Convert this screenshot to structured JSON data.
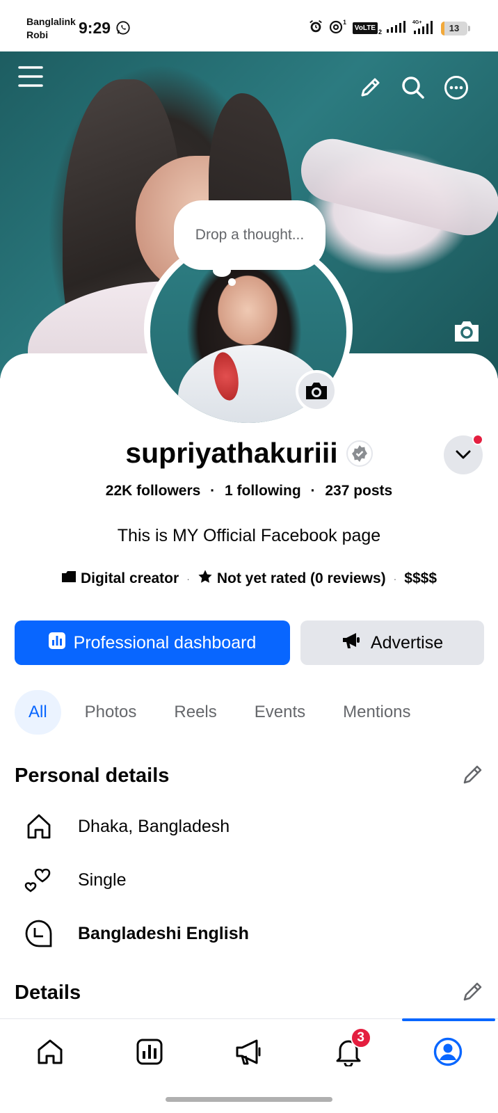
{
  "status_bar": {
    "carrier_line1": "Banglalink",
    "carrier_line2": "Robi",
    "time": "9:29",
    "volte_label": "VoLTE",
    "sim2_label": "2",
    "battery_level": "13",
    "battery_fraction": 0.13,
    "battery_color": "#f2a93b"
  },
  "cover": {
    "icons": [
      "menu-icon",
      "pencil-icon",
      "search-icon",
      "more-icon",
      "camera-icon"
    ]
  },
  "profile": {
    "thought_placeholder": "Drop a thought...",
    "name": "supriyathakuriii",
    "followers": "22K followers",
    "following": "1 following",
    "posts": "237 posts",
    "separator": "·",
    "bio": "This is MY Official Facebook page",
    "category": "Digital creator",
    "rating": "Not yet rated (0 reviews)",
    "price": "$$$$"
  },
  "actions": {
    "primary_label": "Professional dashboard",
    "secondary_label": "Advertise",
    "accent_color": "#0866ff"
  },
  "tabs": [
    {
      "label": "All",
      "active": true
    },
    {
      "label": "Photos",
      "active": false
    },
    {
      "label": "Reels",
      "active": false
    },
    {
      "label": "Events",
      "active": false
    },
    {
      "label": "Mentions",
      "active": false
    }
  ],
  "personal_details": {
    "title": "Personal details",
    "items": [
      {
        "icon": "home-icon",
        "text": "Dhaka, Bangladesh"
      },
      {
        "icon": "hearts-icon",
        "text": "Single"
      },
      {
        "icon": "language-icon",
        "text": "Bangladeshi English"
      }
    ]
  },
  "details": {
    "title": "Details"
  },
  "bottom_nav": {
    "items": [
      "home-icon",
      "dashboard-icon",
      "megaphone-icon",
      "bell-icon",
      "profile-icon"
    ],
    "notification_count": "3",
    "active": "profile-icon"
  }
}
